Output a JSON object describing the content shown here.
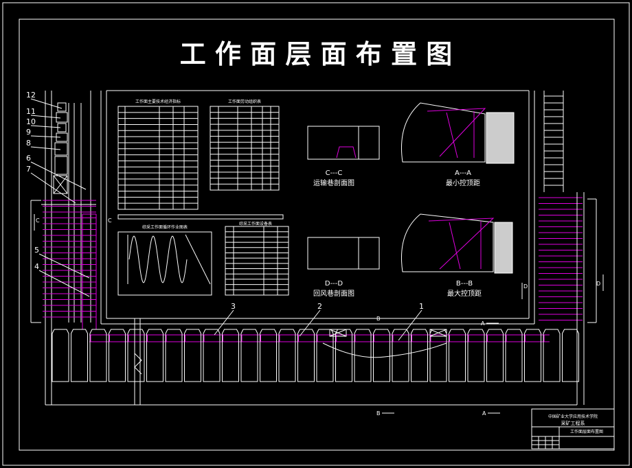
{
  "title": "工 作 面 层 面 布 置 图",
  "sections": {
    "cc": {
      "mark": "C---C",
      "caption": "运输巷剖面图"
    },
    "aa": {
      "mark": "A---A",
      "caption": "最小控顶距"
    },
    "dd": {
      "mark": "D---D",
      "caption": "回风巷剖面图"
    },
    "bb": {
      "mark": "B---B",
      "caption": "最大控顶距"
    }
  },
  "tables": {
    "t1_title": "工作面主要技术经济指标",
    "t2_title": "工作面劳动组织表",
    "t3_title": "综采工作面循环作业图表",
    "t4_title": "综采工作面设备表"
  },
  "callouts": [
    "12",
    "11",
    "10",
    "9",
    "8",
    "6",
    "7",
    "5",
    "4",
    "3",
    "2",
    "1"
  ],
  "markers": {
    "c": "C",
    "d": "D",
    "a": "A",
    "b": "B"
  },
  "titleblock": {
    "school": "中国矿业大学应用技术学院",
    "dept": "采矿工程系",
    "drawing": "工作面层面布置图"
  },
  "colors": {
    "line": "#ffffff",
    "accent": "#e000e0",
    "bg": "#000000"
  }
}
